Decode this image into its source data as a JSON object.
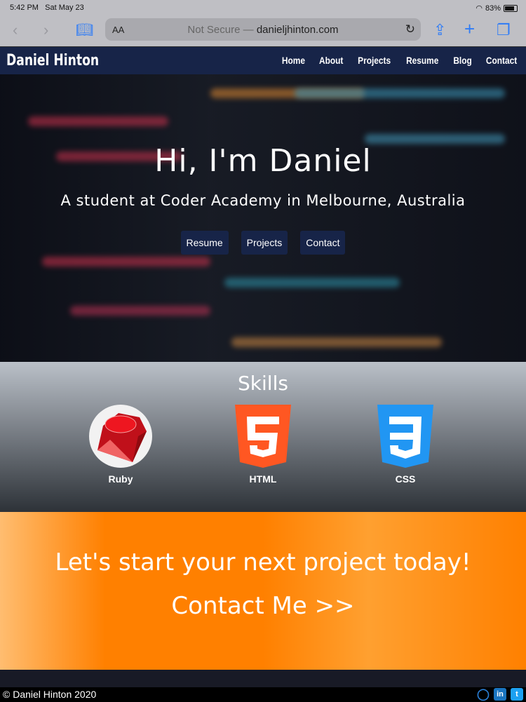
{
  "status": {
    "time": "5:42 PM",
    "date": "Sat May 23",
    "battery": "83%",
    "battery_level": 0.83
  },
  "browser": {
    "text_size": "AA",
    "security": "Not Secure —",
    "domain": "danieljhinton.com"
  },
  "nav": {
    "brand": "Daniel Hinton",
    "links": [
      "Home",
      "About",
      "Projects",
      "Resume",
      "Blog",
      "Contact"
    ]
  },
  "hero": {
    "title": "Hi, I'm Daniel",
    "subtitle": "A student at Coder Academy in Melbourne, Australia",
    "buttons": [
      "Resume",
      "Projects",
      "Contact"
    ]
  },
  "skills": {
    "title": "Skills",
    "items": [
      {
        "label": "Ruby",
        "icon": "ruby-icon"
      },
      {
        "label": "HTML",
        "icon": "html5-icon"
      },
      {
        "label": "CSS",
        "icon": "css3-icon"
      }
    ]
  },
  "cta": {
    "heading": "Let's start your next project today!",
    "link": "Contact Me >>"
  },
  "footer": {
    "copyright": "© Daniel Hinton 2020",
    "social": [
      "github-icon",
      "linkedin-icon",
      "twitter-icon"
    ]
  },
  "colors": {
    "nav": "#172448",
    "accent": "#ff8000"
  }
}
